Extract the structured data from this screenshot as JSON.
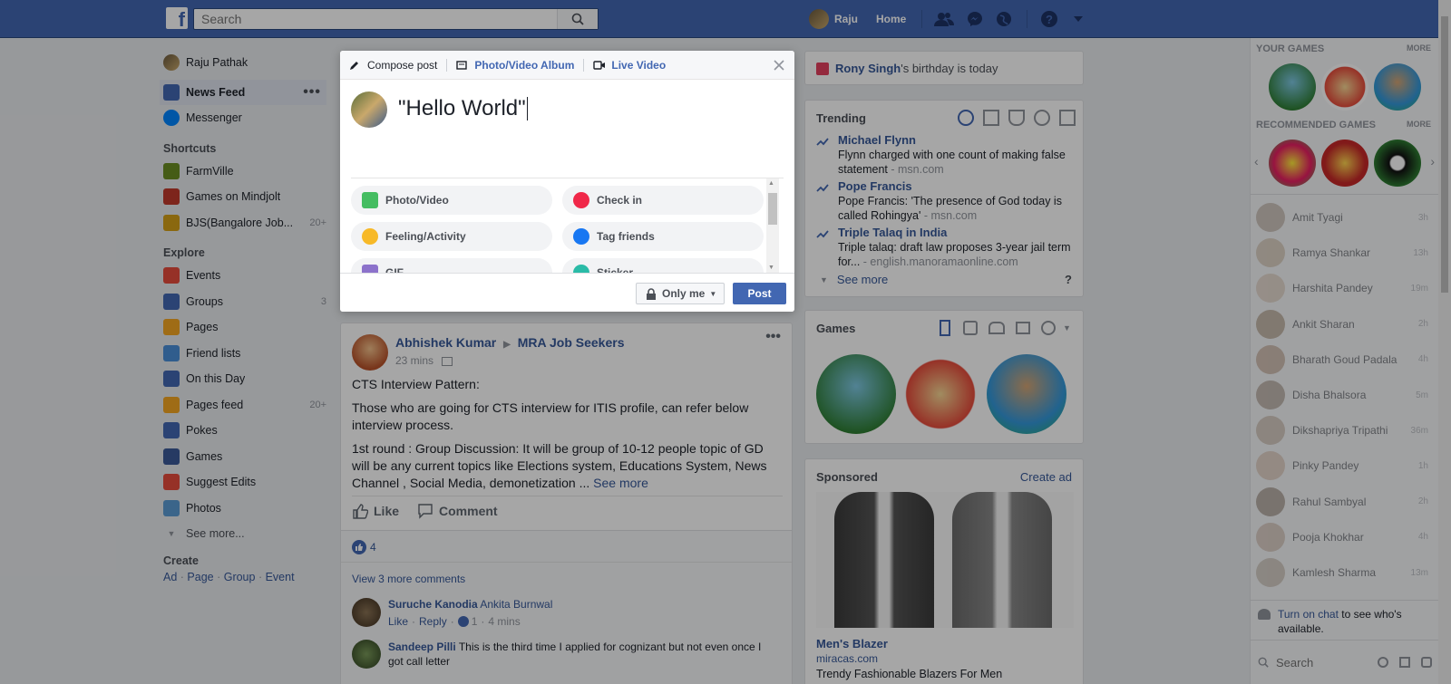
{
  "topbar": {
    "logo": "f",
    "search_placeholder": "Search",
    "user_name": "Raju",
    "home_label": "Home"
  },
  "left_nav": {
    "profile_name": "Raju Pathak",
    "items_top": [
      {
        "label": "News Feed",
        "icon": "news-feed-icon",
        "color": "#4267b2"
      },
      {
        "label": "Messenger",
        "icon": "messenger-icon",
        "color": "#0084ff"
      }
    ],
    "shortcuts_header": "Shortcuts",
    "shortcuts": [
      {
        "label": "FarmVille",
        "icon": "farmville-icon",
        "color": "#6b8e23",
        "count": ""
      },
      {
        "label": "Games on Mindjolt",
        "icon": "mindjolt-icon",
        "color": "#c0392b",
        "count": ""
      },
      {
        "label": "BJS(Bangalore Job...",
        "icon": "trophy-icon",
        "color": "#d4a017",
        "count": "20+"
      }
    ],
    "explore_header": "Explore",
    "explore": [
      {
        "label": "Events",
        "icon": "calendar-icon",
        "color": "#e74c3c",
        "count": ""
      },
      {
        "label": "Groups",
        "icon": "groups-icon",
        "color": "#4267b2",
        "count": "3"
      },
      {
        "label": "Pages",
        "icon": "flag-icon",
        "color": "#f5a623",
        "count": ""
      },
      {
        "label": "Friend lists",
        "icon": "friend-lists-icon",
        "color": "#4a90d9",
        "count": ""
      },
      {
        "label": "On this Day",
        "icon": "clock-icon",
        "color": "#4267b2",
        "count": ""
      },
      {
        "label": "Pages feed",
        "icon": "pages-feed-icon",
        "color": "#f5a623",
        "count": "20+"
      },
      {
        "label": "Pokes",
        "icon": "poke-icon",
        "color": "#4267b2",
        "count": ""
      },
      {
        "label": "Games",
        "icon": "games-icon",
        "color": "#3b5998",
        "count": ""
      },
      {
        "label": "Suggest Edits",
        "icon": "pin-icon",
        "color": "#e74c3c",
        "count": ""
      },
      {
        "label": "Photos",
        "icon": "photos-icon",
        "color": "#5b9bd5",
        "count": ""
      }
    ],
    "see_more": "See more...",
    "create_header": "Create",
    "create_links": [
      "Ad",
      "Page",
      "Group",
      "Event"
    ]
  },
  "composer": {
    "tab_compose": "Compose post",
    "tab_album": "Photo/Video Album",
    "tab_live": "Live Video",
    "text": "\"Hello World\"",
    "options": [
      {
        "label": "Photo/Video",
        "icon": "photo-icon",
        "color": "#45bd62"
      },
      {
        "label": "Check in",
        "icon": "checkin-icon",
        "color": "#f02849"
      },
      {
        "label": "Feeling/Activity",
        "icon": "feeling-icon",
        "color": "#f7b928"
      },
      {
        "label": "Tag friends",
        "icon": "tag-friends-icon",
        "color": "#1877f2"
      },
      {
        "label": "GIF",
        "icon": "gif-icon",
        "color": "#8c72cb"
      },
      {
        "label": "Sticker",
        "icon": "sticker-icon",
        "color": "#2abba7"
      }
    ],
    "privacy": "Only me",
    "post_button": "Post"
  },
  "post": {
    "author": "Abhishek Kumar",
    "group": "MRA Job Seekers",
    "time": "23 mins",
    "paragraphs": [
      "CTS Interview Pattern:",
      "Those who are going for CTS interview for ITIS profile, can refer below interview process.",
      "1st round : Group Discussion: It will be group of 10-12 people topic of GD will be any current topics like Elections system, Educations System, News Channel , Social Media, demonetization ..."
    ],
    "see_more": "See more",
    "like": "Like",
    "comment": "Comment",
    "like_count": "4",
    "view_more_comments": "View 3 more comments",
    "comments": [
      {
        "author": "Suruche Kanodia",
        "text": "Ankita Burnwal",
        "like": "Like",
        "reply": "Reply",
        "likes": "1",
        "time": "4 mins"
      },
      {
        "author": "Sandeep Pilli",
        "text": "This is the third time I applied for cognizant but not even once I got call letter"
      }
    ]
  },
  "birthday": {
    "name": "Rony Singh",
    "text": "'s birthday is today"
  },
  "trending": {
    "title": "Trending",
    "items": [
      {
        "topic": "Michael Flynn",
        "desc": "Flynn charged with one count of making false statement",
        "source": " - msn.com"
      },
      {
        "topic": "Pope Francis",
        "desc": "Pope Francis: 'The presence of God today is called Rohingya'",
        "source": " - msn.com"
      },
      {
        "topic": "Triple Talaq in India",
        "desc": "Triple talaq: draft law proposes 3-year jail term for...",
        "source": " - english.manoramaonline.com"
      }
    ],
    "see_more": "See more",
    "help": "?"
  },
  "games_card": {
    "title": "Games"
  },
  "sponsored": {
    "title": "Sponsored",
    "create_ad": "Create ad",
    "product": "Men's Blazer",
    "site": "miracas.com",
    "desc": "Trendy Fashionable Blazers For Men"
  },
  "sidebar": {
    "your_games": "YOUR GAMES",
    "recommended_games": "RECOMMENDED GAMES",
    "more": "MORE",
    "chat": [
      {
        "name": "Amit Tyagi",
        "time": "3h"
      },
      {
        "name": "Ramya Shankar",
        "time": "13h"
      },
      {
        "name": "Harshita Pandey",
        "time": "19m"
      },
      {
        "name": "Ankit Sharan",
        "time": "2h"
      },
      {
        "name": "Bharath Goud Padala",
        "time": "4h"
      },
      {
        "name": "Disha Bhalsora",
        "time": "5m"
      },
      {
        "name": "Dikshapriya Tripathi",
        "time": "36m"
      },
      {
        "name": "Pinky Pandey",
        "time": "1h"
      },
      {
        "name": "Rahul Sambyal",
        "time": "2h"
      },
      {
        "name": "Pooja Khokhar",
        "time": "4h"
      },
      {
        "name": "Kamlesh Sharma",
        "time": "13m"
      }
    ],
    "turn_on_chat_link": "Turn on chat",
    "turn_on_chat_text": " to see who's available.",
    "search_placeholder": "Search"
  }
}
